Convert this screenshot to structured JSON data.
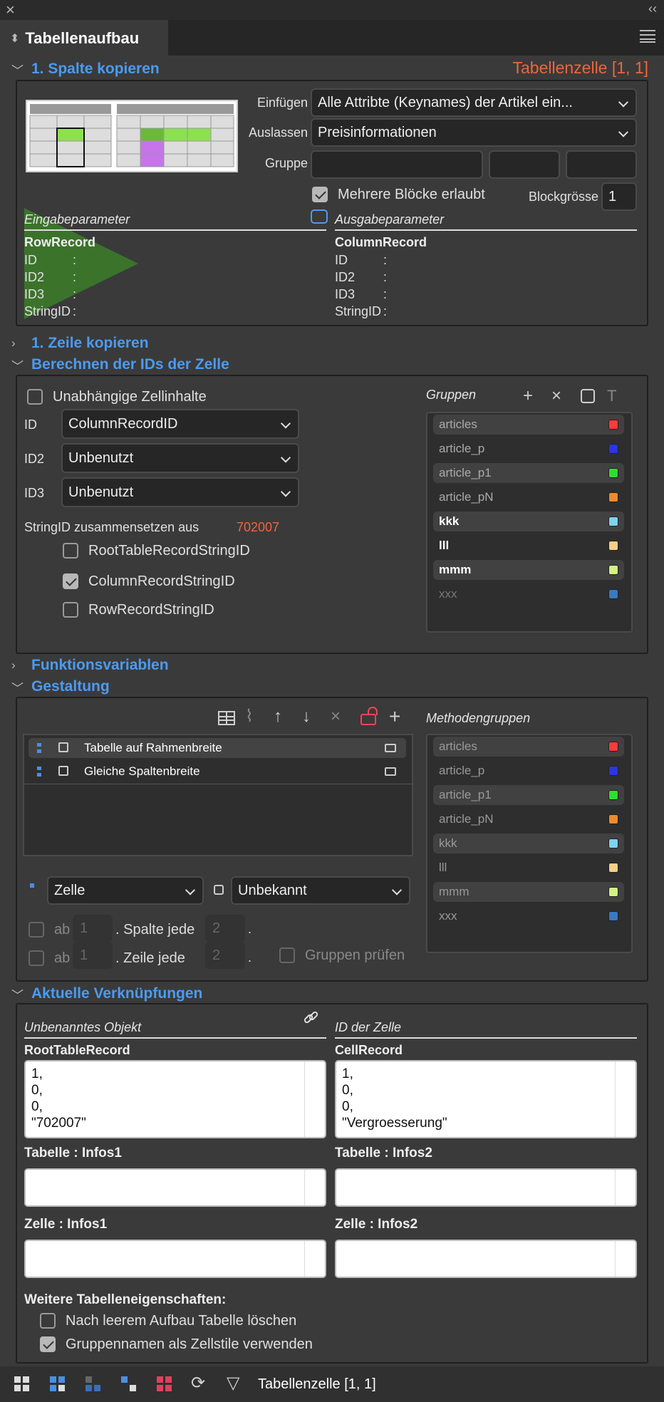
{
  "panel": {
    "title": "Tabellenaufbau"
  },
  "copy_column": {
    "title": "1. Spalte kopieren",
    "cell_ref": "Tabellenzelle [1, 1]",
    "einfuegen_label": "Einfügen",
    "einfuegen_value": "Alle Attribte (Keynames) der Artikel ein...",
    "auslassen_label": "Auslassen",
    "auslassen_value": "Preisinformationen",
    "gruppe_label": "Gruppe",
    "multi_blocks_label": "Mehrere Blöcke erlaubt",
    "blocksize_label": "Blockgrösse",
    "blocksize_value": "1",
    "input_params_label": "Eingabeparameter",
    "output_params_label": "Ausgabeparameter",
    "row_record": "RowRecord",
    "column_record": "ColumnRecord",
    "fields": [
      "ID",
      "ID2",
      "ID3",
      "StringID"
    ],
    "colon": ":"
  },
  "copy_row": {
    "title": "1. Zeile kopieren"
  },
  "calc_ids": {
    "title": "Berechnen der IDs der Zelle",
    "independent_label": "Unabhängige Zellinhalte",
    "id_label": "ID",
    "id_value": "ColumnRecordID",
    "id2_label": "ID2",
    "id2_value": "Unbenutzt",
    "id3_label": "ID3",
    "id3_value": "Unbenutzt",
    "stringid_label": "StringID zusammensetzen aus",
    "stringid_value": "702007",
    "opt_root": "RootTableRecordStringID",
    "opt_column": "ColumnRecordStringID",
    "opt_row": "RowRecordStringID",
    "groups_label": "Gruppen"
  },
  "groups": [
    {
      "name": "articles",
      "color": "#ff3b3b",
      "style": "dim"
    },
    {
      "name": "article_p",
      "color": "#2a35e6",
      "style": "dim"
    },
    {
      "name": "article_p1",
      "color": "#2ee02e",
      "style": "dim"
    },
    {
      "name": "article_pN",
      "color": "#f08a2a",
      "style": "dim"
    },
    {
      "name": "kkk",
      "color": "#7fd2f2",
      "style": "bright"
    },
    {
      "name": "lll",
      "color": "#f5cf85",
      "style": "bright"
    },
    {
      "name": "mmm",
      "color": "#d2f283",
      "style": "bright"
    },
    {
      "name": "xxx",
      "color": "#3a78c2",
      "style": "faded"
    }
  ],
  "funcvars": {
    "title": "Funktionsvariablen"
  },
  "design": {
    "title": "Gestaltung",
    "methods": [
      "Tabelle auf Rahmenbreite",
      "Gleiche Spaltenbreite"
    ],
    "method_groups_label": "Methodengruppen",
    "scope_value": "Zelle",
    "unknown_value": "Unbekannt",
    "ab": "ab",
    "col_every": ". Spalte jede",
    "row_every": ". Zeile jede",
    "num1": "1",
    "num2": "2",
    "dot": ".",
    "check_groups": "Gruppen prüfen"
  },
  "method_groups": [
    {
      "name": "articles",
      "color": "#ff3b3b"
    },
    {
      "name": "article_p",
      "color": "#2a35e6"
    },
    {
      "name": "article_p1",
      "color": "#2ee02e"
    },
    {
      "name": "article_pN",
      "color": "#f08a2a"
    },
    {
      "name": "kkk",
      "color": "#7fd2f2"
    },
    {
      "name": "lll",
      "color": "#f5cf85"
    },
    {
      "name": "mmm",
      "color": "#d2f283"
    },
    {
      "name": "xxx",
      "color": "#3a78c2"
    }
  ],
  "links": {
    "title": "Aktuelle Verknüpfungen",
    "left_head": "Unbenanntes Objekt",
    "right_head": "ID der Zelle",
    "left_record": "RootTableRecord",
    "right_record": "CellRecord",
    "left_values": "1,\n0,\n0,\n\"702007\"",
    "right_values": "1,\n0,\n0,\n\"Vergroesserung\"",
    "tab_infos1": "Tabelle : Infos1",
    "tab_infos2": "Tabelle : Infos2",
    "cell_infos1": "Zelle : Infos1",
    "cell_infos2": "Zelle : Infos2",
    "more_label": "Weitere Tabelleneigenschaften:",
    "opt_delete": "Nach leerem Aufbau Tabelle löschen",
    "opt_styles": "Gruppennamen als Zellstile verwenden"
  },
  "footer": {
    "cell_ref": "Tabellenzelle [1, 1]"
  }
}
